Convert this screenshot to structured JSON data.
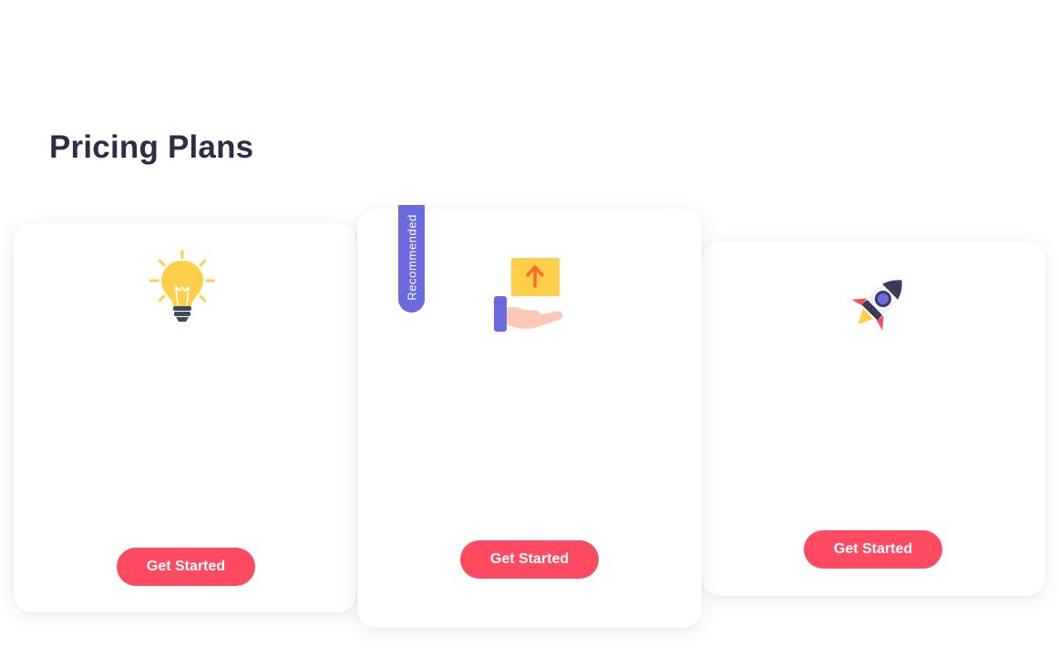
{
  "page": {
    "title": "Pricing Plans"
  },
  "plans": [
    {
      "icon": "lightbulb-icon",
      "button_label": "Get Started"
    },
    {
      "icon": "hand-upload-box-icon",
      "button_label": "Get Started",
      "badge": "Recommended"
    },
    {
      "icon": "rocket-icon",
      "button_label": "Get Started"
    }
  ],
  "colors": {
    "title": "#2f2c4a",
    "button": "#ff4a62",
    "ribbon": "#6b6ae0",
    "background": "#ffffff"
  }
}
